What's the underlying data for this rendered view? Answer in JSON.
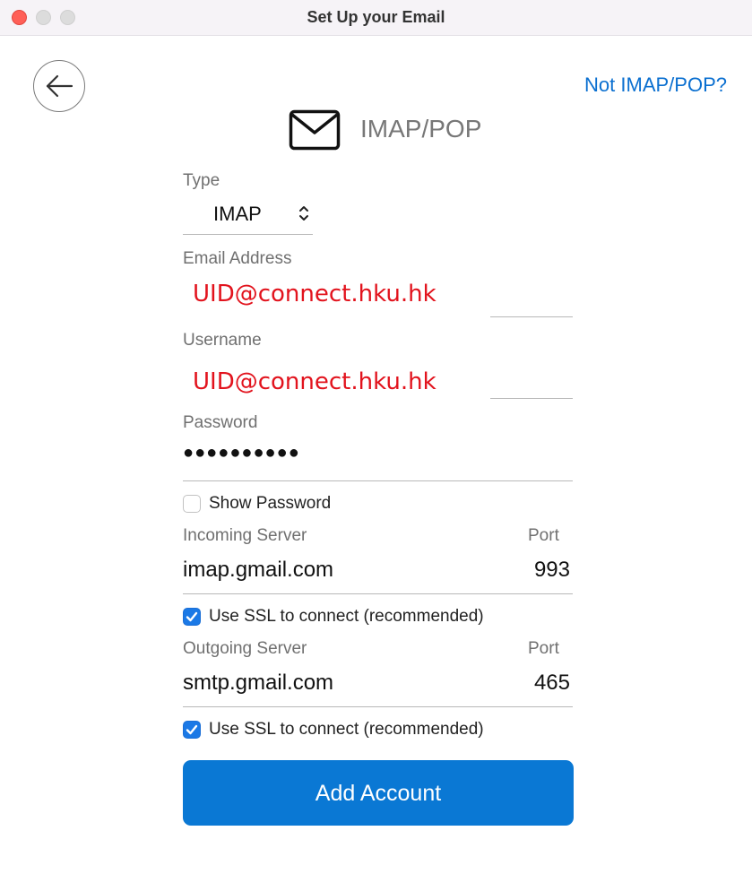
{
  "window": {
    "title": "Set Up your Email"
  },
  "header": {
    "back_icon": "arrow-left-icon",
    "not_imap_link": "Not IMAP/POP?",
    "mail_icon": "envelope-icon",
    "title": "IMAP/POP"
  },
  "form": {
    "type": {
      "label": "Type",
      "value": "IMAP"
    },
    "email": {
      "label": "Email Address",
      "value": "UID@connect.hku.hk"
    },
    "username": {
      "label": "Username",
      "value": "UID@connect.hku.hk"
    },
    "password": {
      "label": "Password",
      "value": "●●●●●●●●●●",
      "show_password_label": "Show Password",
      "show_password_checked": false
    },
    "incoming": {
      "label": "Incoming Server",
      "port_label": "Port",
      "server": "imap.gmail.com",
      "port": "993",
      "ssl_label": "Use SSL to connect (recommended)",
      "ssl_checked": true
    },
    "outgoing": {
      "label": "Outgoing Server",
      "port_label": "Port",
      "server": "smtp.gmail.com",
      "port": "465",
      "ssl_label": "Use SSL to connect (recommended)",
      "ssl_checked": true
    },
    "submit_label": "Add Account"
  },
  "colors": {
    "accent": "#0a78d4",
    "link": "#0a6fd0",
    "annotation_red": "#e2131d",
    "checkbox": "#1b79e6"
  }
}
